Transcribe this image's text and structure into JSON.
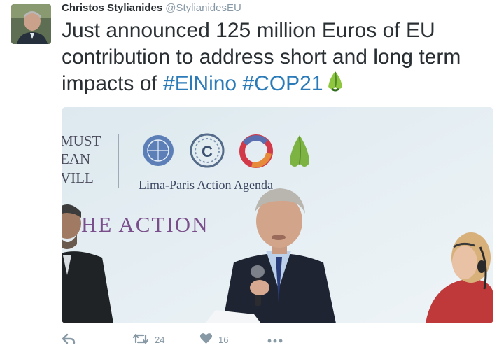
{
  "tweet": {
    "author_name": "Christos Stylianides",
    "author_handle": "@StylianidesEU",
    "text_parts": [
      "Just announced 125 million Euros of EU contribution to address short and long term impacts of ",
      "#ElNino",
      " ",
      "#COP21"
    ],
    "icon": "cop21-leaf-icon"
  },
  "media": {
    "banner_left_lines": [
      "MUST",
      "EAN",
      "VILL"
    ],
    "agenda_title": "Lima-Paris Action Agenda",
    "slogan": "HE ACTION",
    "logos": [
      "un-emblem-icon",
      "unfccc-logo-icon",
      "circle-logo-icon",
      "leaf-logo-icon"
    ]
  },
  "actions": {
    "reply_icon": "reply-icon",
    "retweet_icon": "retweet-icon",
    "retweet_count": "24",
    "like_icon": "heart-icon",
    "like_count": "16",
    "more_icon": "more-icon"
  },
  "colors": {
    "hashtag": "#2b7bb9",
    "action_gray": "#8899a6",
    "slogan_purple": "#7a4e8a"
  }
}
